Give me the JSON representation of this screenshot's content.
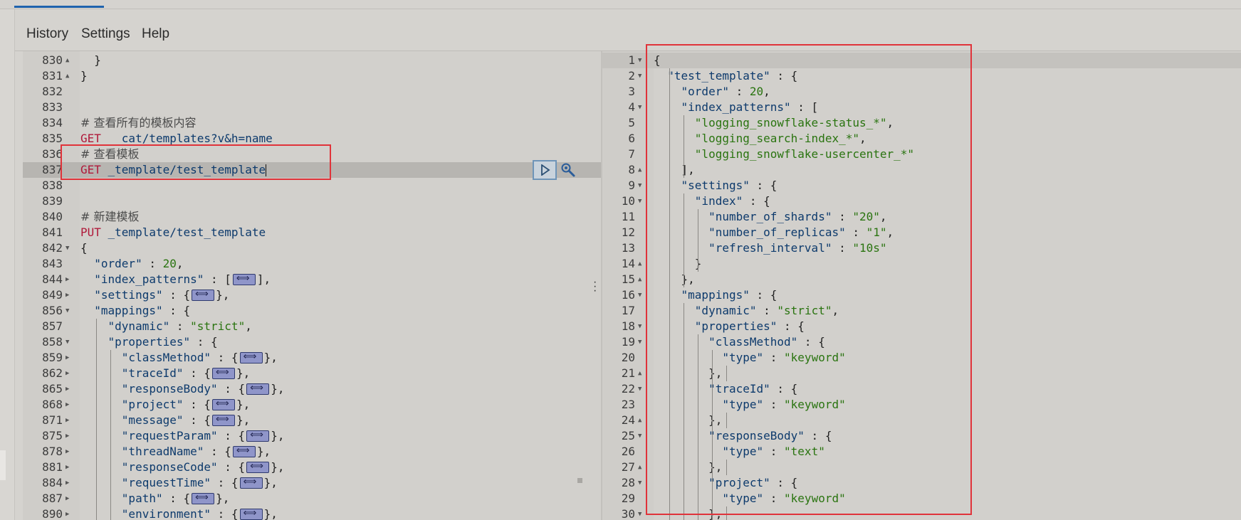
{
  "menu": {
    "history": "History",
    "settings": "Settings",
    "help": "Help"
  },
  "left_editor": {
    "lines": [
      {
        "n": "830",
        "fold": "up",
        "code": [
          [
            "pun",
            "  }"
          ]
        ]
      },
      {
        "n": "831",
        "fold": "up",
        "code": [
          [
            "pun",
            "}"
          ]
        ]
      },
      {
        "n": "832",
        "code": []
      },
      {
        "n": "833",
        "code": []
      },
      {
        "n": "834",
        "code": [
          [
            "comment",
            "# 查看所有的模板内容"
          ]
        ]
      },
      {
        "n": "835",
        "code": [
          [
            "method",
            "GET "
          ],
          [
            "path",
            " _cat/templates?v&h=name"
          ]
        ]
      },
      {
        "n": "836",
        "code": [
          [
            "comment",
            "# 查看模板"
          ]
        ]
      },
      {
        "n": "837",
        "active": true,
        "cursor": true,
        "code": [
          [
            "method",
            "GET "
          ],
          [
            "path",
            "_template/test_template"
          ]
        ]
      },
      {
        "n": "838",
        "code": []
      },
      {
        "n": "839",
        "code": []
      },
      {
        "n": "840",
        "code": [
          [
            "comment",
            "# 新建模板"
          ]
        ]
      },
      {
        "n": "841",
        "code": [
          [
            "method",
            "PUT "
          ],
          [
            "path",
            "_template/test_template"
          ]
        ]
      },
      {
        "n": "842",
        "fold": "down",
        "code": [
          [
            "pun",
            "{"
          ]
        ]
      },
      {
        "n": "843",
        "code": [
          [
            "pun",
            "  "
          ],
          [
            "key",
            "\"order\""
          ],
          [
            "pun",
            " : "
          ],
          [
            "num",
            "20"
          ],
          [
            "pun",
            ","
          ]
        ]
      },
      {
        "n": "844",
        "fold": "right",
        "code": [
          [
            "pun",
            "  "
          ],
          [
            "key",
            "\"index_patterns\""
          ],
          [
            "pun",
            " : ["
          ],
          [
            "col",
            ""
          ],
          [
            "pun",
            "],"
          ]
        ]
      },
      {
        "n": "849",
        "fold": "right",
        "code": [
          [
            "pun",
            "  "
          ],
          [
            "key",
            "\"settings\""
          ],
          [
            "pun",
            " : {"
          ],
          [
            "col",
            ""
          ],
          [
            "pun",
            "},"
          ]
        ]
      },
      {
        "n": "856",
        "fold": "down",
        "code": [
          [
            "pun",
            "  "
          ],
          [
            "key",
            "\"mappings\""
          ],
          [
            "pun",
            " : {"
          ]
        ]
      },
      {
        "n": "857",
        "code": [
          [
            "pun",
            "    "
          ],
          [
            "key",
            "\"dynamic\""
          ],
          [
            "pun",
            " : "
          ],
          [
            "str",
            "\"strict\""
          ],
          [
            "pun",
            ","
          ]
        ]
      },
      {
        "n": "858",
        "fold": "down",
        "code": [
          [
            "pun",
            "    "
          ],
          [
            "key",
            "\"properties\""
          ],
          [
            "pun",
            " : {"
          ]
        ]
      },
      {
        "n": "859",
        "fold": "right",
        "code": [
          [
            "pun",
            "      "
          ],
          [
            "key",
            "\"classMethod\""
          ],
          [
            "pun",
            " : {"
          ],
          [
            "col",
            ""
          ],
          [
            "pun",
            "},"
          ]
        ]
      },
      {
        "n": "862",
        "fold": "right",
        "code": [
          [
            "pun",
            "      "
          ],
          [
            "key",
            "\"traceId\""
          ],
          [
            "pun",
            " : {"
          ],
          [
            "col",
            ""
          ],
          [
            "pun",
            "},"
          ]
        ]
      },
      {
        "n": "865",
        "fold": "right",
        "code": [
          [
            "pun",
            "      "
          ],
          [
            "key",
            "\"responseBody\""
          ],
          [
            "pun",
            " : {"
          ],
          [
            "col",
            ""
          ],
          [
            "pun",
            "},"
          ]
        ]
      },
      {
        "n": "868",
        "fold": "right",
        "code": [
          [
            "pun",
            "      "
          ],
          [
            "key",
            "\"project\""
          ],
          [
            "pun",
            " : {"
          ],
          [
            "col",
            ""
          ],
          [
            "pun",
            "},"
          ]
        ]
      },
      {
        "n": "871",
        "fold": "right",
        "code": [
          [
            "pun",
            "      "
          ],
          [
            "key",
            "\"message\""
          ],
          [
            "pun",
            " : {"
          ],
          [
            "col",
            ""
          ],
          [
            "pun",
            "},"
          ]
        ]
      },
      {
        "n": "875",
        "fold": "right",
        "code": [
          [
            "pun",
            "      "
          ],
          [
            "key",
            "\"requestParam\""
          ],
          [
            "pun",
            " : {"
          ],
          [
            "col",
            ""
          ],
          [
            "pun",
            "},"
          ]
        ]
      },
      {
        "n": "878",
        "fold": "right",
        "code": [
          [
            "pun",
            "      "
          ],
          [
            "key",
            "\"threadName\""
          ],
          [
            "pun",
            " : {"
          ],
          [
            "col",
            ""
          ],
          [
            "pun",
            "},"
          ]
        ]
      },
      {
        "n": "881",
        "fold": "right",
        "code": [
          [
            "pun",
            "      "
          ],
          [
            "key",
            "\"responseCode\""
          ],
          [
            "pun",
            " : {"
          ],
          [
            "col",
            ""
          ],
          [
            "pun",
            "},"
          ]
        ]
      },
      {
        "n": "884",
        "fold": "right",
        "code": [
          [
            "pun",
            "      "
          ],
          [
            "key",
            "\"requestTime\""
          ],
          [
            "pun",
            " : {"
          ],
          [
            "col",
            ""
          ],
          [
            "pun",
            "},"
          ]
        ]
      },
      {
        "n": "887",
        "fold": "right",
        "code": [
          [
            "pun",
            "      "
          ],
          [
            "key",
            "\"path\""
          ],
          [
            "pun",
            " : {"
          ],
          [
            "col",
            ""
          ],
          [
            "pun",
            "},"
          ]
        ]
      },
      {
        "n": "890",
        "fold": "right",
        "code": [
          [
            "pun",
            "      "
          ],
          [
            "key",
            "\"environment\""
          ],
          [
            "pun",
            " : {"
          ],
          [
            "col",
            ""
          ],
          [
            "pun",
            "},"
          ]
        ]
      }
    ]
  },
  "right_editor": {
    "lines": [
      {
        "n": "1",
        "fold": "down",
        "active": true,
        "code": [
          [
            "pun",
            "{"
          ]
        ]
      },
      {
        "n": "2",
        "fold": "down",
        "code": [
          [
            "pun",
            "  "
          ],
          [
            "key",
            "\"test_template\""
          ],
          [
            "pun",
            " : {"
          ]
        ]
      },
      {
        "n": "3",
        "code": [
          [
            "pun",
            "    "
          ],
          [
            "key",
            "\"order\""
          ],
          [
            "pun",
            " : "
          ],
          [
            "num",
            "20"
          ],
          [
            "pun",
            ","
          ]
        ]
      },
      {
        "n": "4",
        "fold": "down",
        "code": [
          [
            "pun",
            "    "
          ],
          [
            "key",
            "\"index_patterns\""
          ],
          [
            "pun",
            " : ["
          ]
        ]
      },
      {
        "n": "5",
        "code": [
          [
            "pun",
            "      "
          ],
          [
            "str",
            "\"logging_snowflake-status_*\""
          ],
          [
            "pun",
            ","
          ]
        ]
      },
      {
        "n": "6",
        "code": [
          [
            "pun",
            "      "
          ],
          [
            "str",
            "\"logging_search-index_*\""
          ],
          [
            "pun",
            ","
          ]
        ]
      },
      {
        "n": "7",
        "code": [
          [
            "pun",
            "      "
          ],
          [
            "str",
            "\"logging_snowflake-usercenter_*\""
          ]
        ]
      },
      {
        "n": "8",
        "fold": "up",
        "code": [
          [
            "pun",
            "    ],"
          ]
        ]
      },
      {
        "n": "9",
        "fold": "down",
        "code": [
          [
            "pun",
            "    "
          ],
          [
            "key",
            "\"settings\""
          ],
          [
            "pun",
            " : {"
          ]
        ]
      },
      {
        "n": "10",
        "fold": "down",
        "code": [
          [
            "pun",
            "      "
          ],
          [
            "key",
            "\"index\""
          ],
          [
            "pun",
            " : {"
          ]
        ]
      },
      {
        "n": "11",
        "code": [
          [
            "pun",
            "        "
          ],
          [
            "key",
            "\"number_of_shards\""
          ],
          [
            "pun",
            " : "
          ],
          [
            "str",
            "\"20\""
          ],
          [
            "pun",
            ","
          ]
        ]
      },
      {
        "n": "12",
        "code": [
          [
            "pun",
            "        "
          ],
          [
            "key",
            "\"number_of_replicas\""
          ],
          [
            "pun",
            " : "
          ],
          [
            "str",
            "\"1\""
          ],
          [
            "pun",
            ","
          ]
        ]
      },
      {
        "n": "13",
        "code": [
          [
            "pun",
            "        "
          ],
          [
            "key",
            "\"refresh_interval\""
          ],
          [
            "pun",
            " : "
          ],
          [
            "str",
            "\"10s\""
          ]
        ]
      },
      {
        "n": "14",
        "fold": "up",
        "code": [
          [
            "pun",
            "      }"
          ]
        ]
      },
      {
        "n": "15",
        "fold": "up",
        "code": [
          [
            "pun",
            "    },"
          ]
        ]
      },
      {
        "n": "16",
        "fold": "down",
        "code": [
          [
            "pun",
            "    "
          ],
          [
            "key",
            "\"mappings\""
          ],
          [
            "pun",
            " : {"
          ]
        ]
      },
      {
        "n": "17",
        "code": [
          [
            "pun",
            "      "
          ],
          [
            "key",
            "\"dynamic\""
          ],
          [
            "pun",
            " : "
          ],
          [
            "str",
            "\"strict\""
          ],
          [
            "pun",
            ","
          ]
        ]
      },
      {
        "n": "18",
        "fold": "down",
        "code": [
          [
            "pun",
            "      "
          ],
          [
            "key",
            "\"properties\""
          ],
          [
            "pun",
            " : {"
          ]
        ]
      },
      {
        "n": "19",
        "fold": "down",
        "code": [
          [
            "pun",
            "        "
          ],
          [
            "key",
            "\"classMethod\""
          ],
          [
            "pun",
            " : {"
          ]
        ]
      },
      {
        "n": "20",
        "code": [
          [
            "pun",
            "          "
          ],
          [
            "key",
            "\"type\""
          ],
          [
            "pun",
            " : "
          ],
          [
            "str",
            "\"keyword\""
          ]
        ]
      },
      {
        "n": "21",
        "fold": "up",
        "code": [
          [
            "pun",
            "        },"
          ]
        ]
      },
      {
        "n": "22",
        "fold": "down",
        "code": [
          [
            "pun",
            "        "
          ],
          [
            "key",
            "\"traceId\""
          ],
          [
            "pun",
            " : {"
          ]
        ]
      },
      {
        "n": "23",
        "code": [
          [
            "pun",
            "          "
          ],
          [
            "key",
            "\"type\""
          ],
          [
            "pun",
            " : "
          ],
          [
            "str",
            "\"keyword\""
          ]
        ]
      },
      {
        "n": "24",
        "fold": "up",
        "code": [
          [
            "pun",
            "        },"
          ]
        ]
      },
      {
        "n": "25",
        "fold": "down",
        "code": [
          [
            "pun",
            "        "
          ],
          [
            "key",
            "\"responseBody\""
          ],
          [
            "pun",
            " : {"
          ]
        ]
      },
      {
        "n": "26",
        "code": [
          [
            "pun",
            "          "
          ],
          [
            "key",
            "\"type\""
          ],
          [
            "pun",
            " : "
          ],
          [
            "str",
            "\"text\""
          ]
        ]
      },
      {
        "n": "27",
        "fold": "up",
        "code": [
          [
            "pun",
            "        },"
          ]
        ]
      },
      {
        "n": "28",
        "fold": "down",
        "code": [
          [
            "pun",
            "        "
          ],
          [
            "key",
            "\"project\""
          ],
          [
            "pun",
            " : {"
          ]
        ]
      },
      {
        "n": "29",
        "code": [
          [
            "pun",
            "          "
          ],
          [
            "key",
            "\"type\""
          ],
          [
            "pun",
            " : "
          ],
          [
            "str",
            "\"keyword\""
          ]
        ]
      },
      {
        "n": "30",
        "fold": "down",
        "code": [
          [
            "pun",
            "        },"
          ]
        ]
      }
    ]
  },
  "colors": {
    "accent": "#1f63ad",
    "method": "#b0193a",
    "string": "#2a7410",
    "key": "#0d3a6c",
    "highlight_box": "#e0333a"
  },
  "icons": {
    "run": "play-icon",
    "options": "wrench-icon",
    "collapsed": "collapsed-object-icon"
  }
}
